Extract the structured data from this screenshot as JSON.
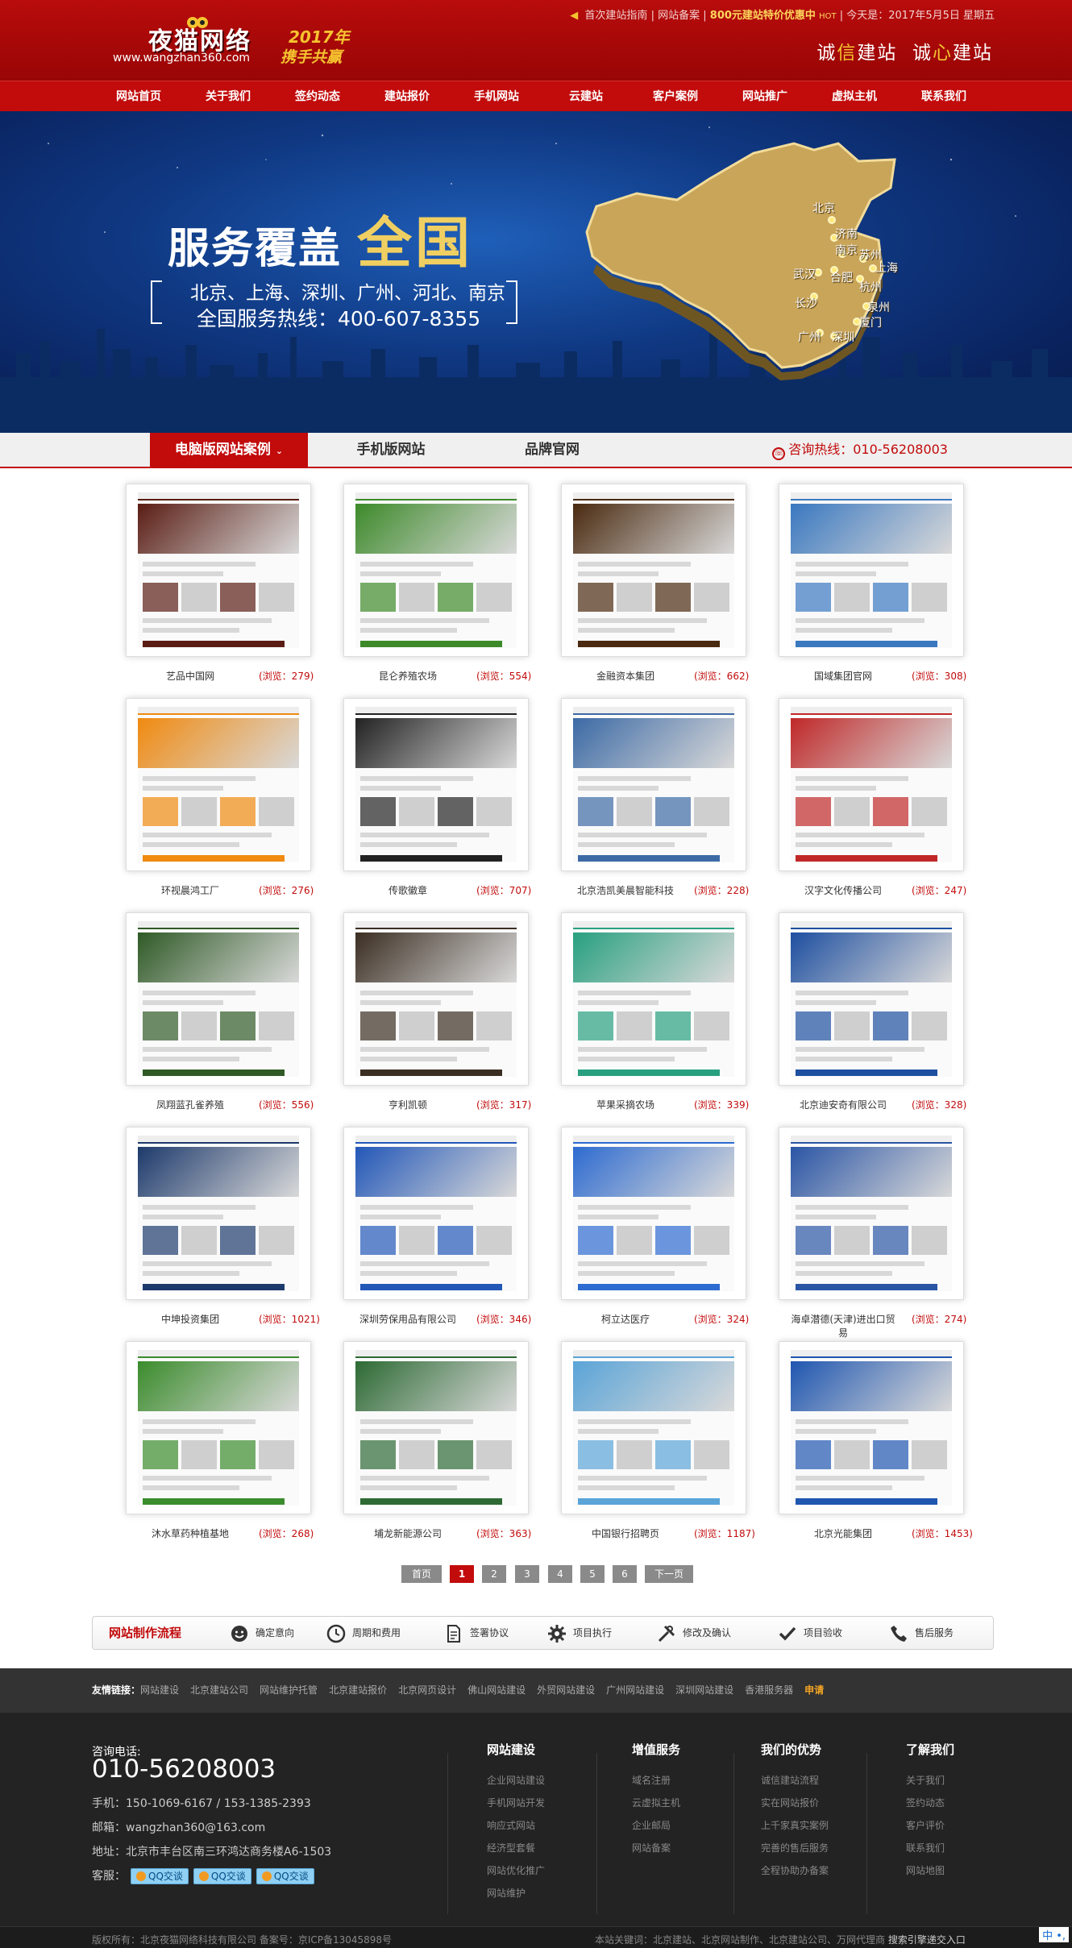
{
  "header": {
    "logo_text": "夜猫网络",
    "logo_url": "www.wangzhan360.com",
    "slogan_year": "2017年",
    "slogan_sub": "携手共赢",
    "topbar": {
      "link1": "首次建站指南",
      "sep": "|",
      "link2": "网站备案",
      "promo": "800元建站特价优惠中",
      "hot": "HOT",
      "date": "今天是：2017年5月5日 星期五"
    },
    "tagline": {
      "a": "诚",
      "b": "信",
      "c": "建站  诚",
      "d": "心",
      "e": "建站"
    }
  },
  "nav": [
    "网站首页",
    "关于我们",
    "签约动态",
    "建站报价",
    "手机网站",
    "云建站",
    "客户案例",
    "网站推广",
    "虚拟主机",
    "联系我们"
  ],
  "banner": {
    "title1": "服务覆盖",
    "title2": "全国",
    "cities_line": "北京、上海、深圳、广州、河北、南京",
    "hotline": "全国服务热线：400-607-8355",
    "map_cities": [
      "北京",
      "济南",
      "南京",
      "苏州",
      "上海",
      "杭州",
      "合肥",
      "武汉",
      "长沙",
      "泉州",
      "厦门",
      "广州",
      "深圳"
    ]
  },
  "tabs": {
    "active": "电脑版网站案例",
    "tab2": "手机版网站",
    "tab3": "品牌官网",
    "hotline": "咨询热线：010-56208003"
  },
  "cases": [
    {
      "name": "艺品中国网",
      "views": "(浏览：279)",
      "theme": "#5a1d14"
    },
    {
      "name": "昆仑养殖农场",
      "views": "(浏览：554)",
      "theme": "#3d8a2a"
    },
    {
      "name": "金融资本集团",
      "views": "(浏览：662)",
      "theme": "#4a2a10"
    },
    {
      "name": "国域集团官网",
      "views": "(浏览：308)",
      "theme": "#3a78c0"
    },
    {
      "name": "环视晨鸿工厂",
      "views": "(浏览：276)",
      "theme": "#f08a10"
    },
    {
      "name": "传歌徽章",
      "views": "(浏览：707)",
      "theme": "#222222"
    },
    {
      "name": "北京浩凯美晨智能科技",
      "views": "(浏览：228)",
      "theme": "#3c6aa5"
    },
    {
      "name": "汉字文化传播公司",
      "views": "(浏览：247)",
      "theme": "#c02828"
    },
    {
      "name": "凤翔蓝孔雀养殖",
      "views": "(浏览：556)",
      "theme": "#2f5a26"
    },
    {
      "name": "亨利凯顿",
      "views": "(浏览：317)",
      "theme": "#3b2e22"
    },
    {
      "name": "苹果采摘农场",
      "views": "(浏览：339)",
      "theme": "#28a080"
    },
    {
      "name": "北京迪安奇有限公司",
      "views": "(浏览：328)",
      "theme": "#1e4fa0"
    },
    {
      "name": "中坤投资集团",
      "views": "(浏览：1021)",
      "theme": "#1d3a6c"
    },
    {
      "name": "深圳劳保用品有限公司",
      "views": "(浏览：346)",
      "theme": "#2257b8"
    },
    {
      "name": "柯立达医疗",
      "views": "(浏览：324)",
      "theme": "#2d6bd0"
    },
    {
      "name": "海卓潜德(天津)进出口贸易",
      "views": "(浏览：274)",
      "theme": "#2a55a5"
    },
    {
      "name": "沐水草药种植基地",
      "views": "(浏览：268)",
      "theme": "#3b8c2c"
    },
    {
      "name": "埔龙新能源公司",
      "views": "(浏览：363)",
      "theme": "#2d6a34"
    },
    {
      "name": "中国银行招聘页",
      "views": "(浏览：1187)",
      "theme": "#5aa4d8"
    },
    {
      "name": "北京光能集团",
      "views": "(浏览：1453)",
      "theme": "#1f56b0"
    }
  ],
  "pager": {
    "first": "首页",
    "pages": [
      "1",
      "2",
      "3",
      "4",
      "5",
      "6"
    ],
    "next": "下一页"
  },
  "process": {
    "title": "网站制作流程",
    "steps": [
      {
        "label": "确定意向",
        "icon": "smile-icon"
      },
      {
        "label": "周期和费用",
        "icon": "clock-icon"
      },
      {
        "label": "签署协议",
        "icon": "document-icon"
      },
      {
        "label": "项目执行",
        "icon": "gear-icon"
      },
      {
        "label": "修改及确认",
        "icon": "tools-icon"
      },
      {
        "label": "项目验收",
        "icon": "check-icon"
      },
      {
        "label": "售后服务",
        "icon": "phone-icon"
      }
    ]
  },
  "friend_links": {
    "label": "友情链接：",
    "items": [
      "网站建设",
      "北京建站公司",
      "网站维护托管",
      "北京建站报价",
      "北京网页设计",
      "佛山网站建设",
      "外贸网站建设",
      "广州网站建设",
      "深圳网站建设",
      "香港服务器"
    ],
    "apply": "申请"
  },
  "footer": {
    "consult_label": "咨询电话:",
    "phone": "010-56208003",
    "mobile": "手机：150-1069-6167 / 153-1385-2393",
    "email": "邮箱：wangzhan360@163.com",
    "address": "地址：北京市丰台区南三环鸿达商务楼A6-1503",
    "service_label": "客服：",
    "qq_label": "QQ交谈",
    "columns": [
      {
        "title": "网站建设",
        "items": [
          "企业网站建设",
          "手机网站开发",
          "响应式网站",
          "经济型套餐",
          "网站优化推广",
          "网站维护"
        ]
      },
      {
        "title": "增值服务",
        "items": [
          "域名注册",
          "云虚拟主机",
          "企业邮局",
          "网站备案"
        ]
      },
      {
        "title": "我们的优势",
        "items": [
          "诚信建站流程",
          "实在网站报价",
          "上千家真实案例",
          "完善的售后服务",
          "全程协助办备案"
        ]
      },
      {
        "title": "了解我们",
        "items": [
          "关于我们",
          "签约动态",
          "客户评价",
          "联系我们",
          "网站地图"
        ]
      }
    ],
    "copyright": "版权所有：北京夜猫网络科技有限公司 备案号：京ICP备13045898号",
    "keywords": "本站关键词：北京建站、北京网站制作、北京建站公司、万网代理商",
    "keywords_end": "搜索引擎递交入口",
    "ime": "中 •,"
  },
  "colors": {
    "brand_red": "#c20b0b",
    "gold": "#f5c330",
    "footer_bg": "#232323"
  }
}
